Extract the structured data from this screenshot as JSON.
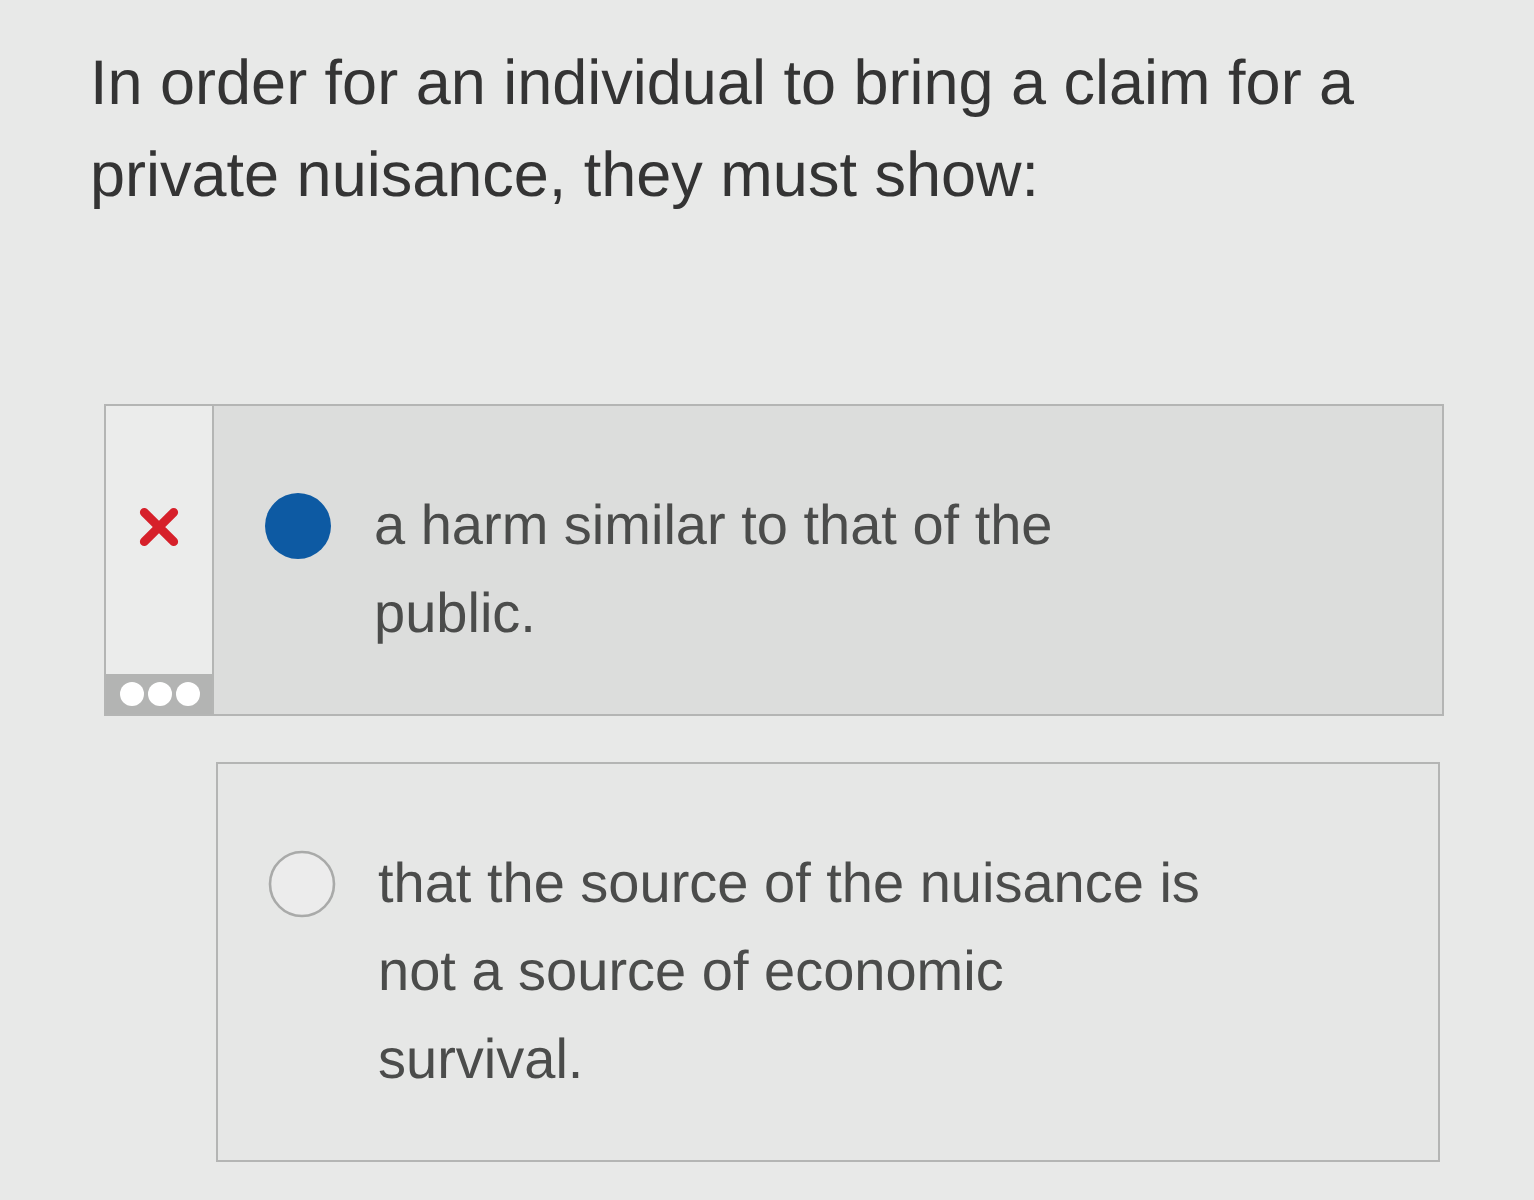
{
  "question": {
    "text": "In order for an individual to bring a claim for a private nuisance, they must show:"
  },
  "options": [
    {
      "text": "a harm similar to that of the public.",
      "selected": true,
      "marked_wrong": true
    },
    {
      "text": "that the source of the nuisance is not a source of economic survival.",
      "selected": false,
      "marked_wrong": false
    }
  ]
}
